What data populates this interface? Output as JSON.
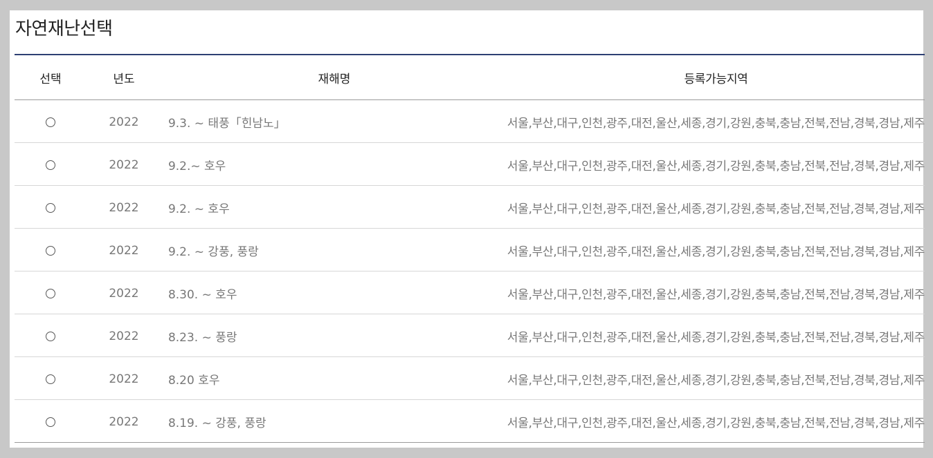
{
  "title": "자연재난선택",
  "columns": {
    "select": "선택",
    "year": "년도",
    "name": "재해명",
    "region": "등록가능지역"
  },
  "rows": [
    {
      "year": "2022",
      "name": "9.3. ~ 태풍「힌남노」",
      "region": "서울,부산,대구,인천,광주,대전,울산,세종,경기,강원,충북,충남,전북,전남,경북,경남,제주"
    },
    {
      "year": "2022",
      "name": "9.2.~ 호우",
      "region": "서울,부산,대구,인천,광주,대전,울산,세종,경기,강원,충북,충남,전북,전남,경북,경남,제주"
    },
    {
      "year": "2022",
      "name": "9.2. ~ 호우",
      "region": "서울,부산,대구,인천,광주,대전,울산,세종,경기,강원,충북,충남,전북,전남,경북,경남,제주"
    },
    {
      "year": "2022",
      "name": "9.2. ~ 강풍, 풍랑",
      "region": "서울,부산,대구,인천,광주,대전,울산,세종,경기,강원,충북,충남,전북,전남,경북,경남,제주"
    },
    {
      "year": "2022",
      "name": "8.30. ~ 호우",
      "region": "서울,부산,대구,인천,광주,대전,울산,세종,경기,강원,충북,충남,전북,전남,경북,경남,제주"
    },
    {
      "year": "2022",
      "name": "8.23. ~ 풍랑",
      "region": "서울,부산,대구,인천,광주,대전,울산,세종,경기,강원,충북,충남,전북,전남,경북,경남,제주"
    },
    {
      "year": "2022",
      "name": "8.20 호우",
      "region": "서울,부산,대구,인천,광주,대전,울산,세종,경기,강원,충북,충남,전북,전남,경북,경남,제주"
    },
    {
      "year": "2022",
      "name": "8.19. ~ 강풍, 풍랑",
      "region": "서울,부산,대구,인천,광주,대전,울산,세종,경기,강원,충북,충남,전북,전남,경북,경남,제주"
    }
  ]
}
